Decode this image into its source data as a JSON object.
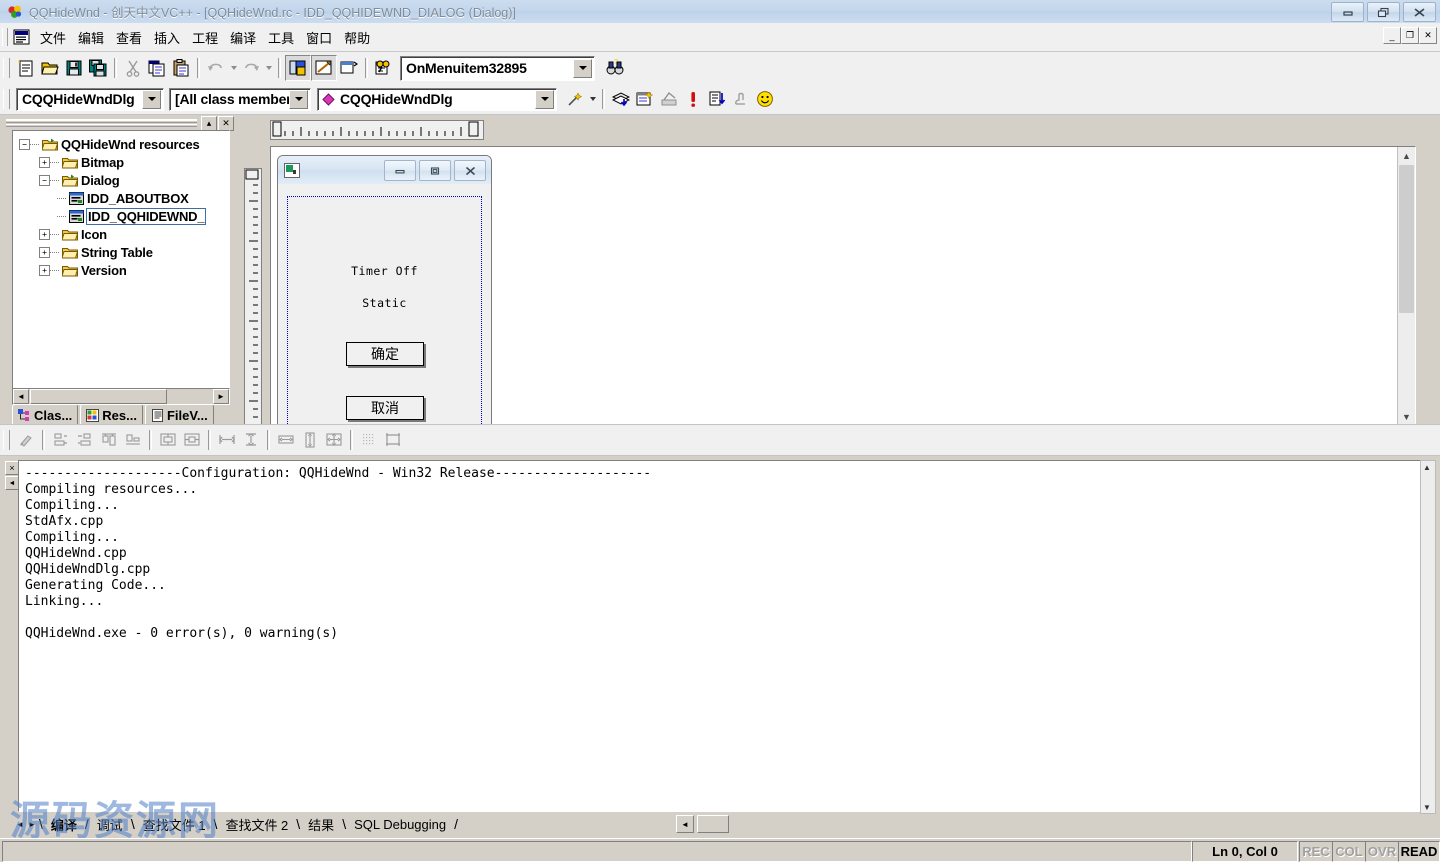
{
  "window": {
    "title": "QQHideWnd - 创天中文VC++ - [QQHideWnd.rc - IDD_QQHIDEWND_DIALOG (Dialog)]",
    "app_icon": "vcpp-logo-icon",
    "minimize_label": "",
    "restore_label": "",
    "close_label": ""
  },
  "menubar": {
    "items": [
      {
        "label": "文件"
      },
      {
        "label": "编辑"
      },
      {
        "label": "查看"
      },
      {
        "label": "插入"
      },
      {
        "label": "工程"
      },
      {
        "label": "编译"
      },
      {
        "label": "工具"
      },
      {
        "label": "窗口"
      },
      {
        "label": "帮助"
      }
    ],
    "mdi": {
      "minimize": "_",
      "restore": "❐",
      "close": "✕"
    }
  },
  "toolbar_standard": {
    "buttons": [
      {
        "name": "new-file-icon",
        "title": "New"
      },
      {
        "name": "open-file-icon",
        "title": "Open"
      },
      {
        "name": "save-icon",
        "title": "Save"
      },
      {
        "name": "save-all-icon",
        "title": "Save All"
      },
      {
        "name": "cut-icon",
        "title": "Cut"
      },
      {
        "name": "copy-icon",
        "title": "Copy"
      },
      {
        "name": "paste-icon",
        "title": "Paste"
      },
      {
        "name": "undo-icon",
        "title": "Undo"
      },
      {
        "name": "redo-icon",
        "title": "Redo"
      },
      {
        "name": "workspace-icon",
        "title": "Workspace"
      },
      {
        "name": "output-window-icon",
        "title": "Output"
      },
      {
        "name": "window-list-icon",
        "title": "Windows"
      },
      {
        "name": "find-in-files-icon",
        "title": "Find in Files"
      },
      {
        "name": "search-binoculars-icon",
        "title": "Find"
      }
    ],
    "find_combo": {
      "value": "OnMenuitem32895",
      "placeholder": "Find"
    }
  },
  "toolbar_wizardbar": {
    "class_combo": {
      "value": "CQQHideWndDlg"
    },
    "filter_combo": {
      "value": "[All class members]"
    },
    "member_combo": {
      "value": "CQQHideWndDlg"
    },
    "buttons": [
      {
        "name": "wizard-wand-icon"
      },
      {
        "name": "compile-icon"
      },
      {
        "name": "build-icon"
      },
      {
        "name": "stop-build-icon"
      },
      {
        "name": "execute-icon"
      },
      {
        "name": "go-debug-icon"
      },
      {
        "name": "insert-breakpoint-icon"
      },
      {
        "name": "smiley-icon"
      }
    ]
  },
  "workspace": {
    "caption_buttons": {
      "maximize": "▴",
      "close": "✕"
    },
    "tree": [
      {
        "label": "QQHideWnd resources",
        "level": 0,
        "expander": "-",
        "icon": "open-folder-icon",
        "selected": false
      },
      {
        "label": "Bitmap",
        "level": 1,
        "expander": "+",
        "icon": "folder-icon",
        "selected": false
      },
      {
        "label": "Dialog",
        "level": 1,
        "expander": "-",
        "icon": "open-folder-icon",
        "selected": false
      },
      {
        "label": "IDD_ABOUTBOX",
        "level": 2,
        "expander": "",
        "icon": "dialog-resource-icon",
        "selected": false
      },
      {
        "label": "IDD_QQHIDEWND_",
        "level": 2,
        "expander": "",
        "icon": "dialog-resource-icon",
        "selected": true
      },
      {
        "label": "Icon",
        "level": 1,
        "expander": "+",
        "icon": "folder-icon",
        "selected": false
      },
      {
        "label": "String Table",
        "level": 1,
        "expander": "+",
        "icon": "folder-icon",
        "selected": false
      },
      {
        "label": "Version",
        "level": 1,
        "expander": "+",
        "icon": "folder-icon",
        "selected": false
      }
    ],
    "tabs": [
      {
        "label": "Clas...",
        "icon": "classview-icon",
        "active": false
      },
      {
        "label": "Res...",
        "icon": "resourceview-icon",
        "active": true
      },
      {
        "label": "FileV...",
        "icon": "fileview-icon",
        "active": false
      }
    ]
  },
  "dialog_editor": {
    "window_icon": "dialog-app-icon",
    "window_buttons": {
      "minimize": "minimize-icon",
      "maximize": "maximize-icon",
      "close": "close-icon"
    },
    "controls": [
      {
        "type": "static",
        "text": "Timer Off"
      },
      {
        "type": "static",
        "text": "Static"
      },
      {
        "type": "button",
        "text": "确定"
      },
      {
        "type": "button",
        "text": "取消"
      }
    ]
  },
  "toolbar_dialog_layout": {
    "buttons": [
      {
        "name": "test-dialog-icon"
      },
      {
        "name": "align-left-icon"
      },
      {
        "name": "align-right-icon"
      },
      {
        "name": "align-top-icon"
      },
      {
        "name": "align-bottom-icon"
      },
      {
        "name": "center-vertical-icon"
      },
      {
        "name": "center-horizontal-icon"
      },
      {
        "name": "space-across-icon"
      },
      {
        "name": "space-down-icon"
      },
      {
        "name": "make-same-width-icon"
      },
      {
        "name": "make-same-height-icon"
      },
      {
        "name": "make-same-size-icon"
      },
      {
        "name": "toggle-grid-icon"
      },
      {
        "name": "toggle-guides-icon"
      }
    ]
  },
  "output": {
    "text": "--------------------Configuration: QQHideWnd - Win32 Release--------------------\nCompiling resources...\nCompiling...\nStdAfx.cpp\nCompiling...\nQQHideWnd.cpp\nQQHideWndDlg.cpp\nGenerating Code...\nLinking...\n\nQQHideWnd.exe - 0 error(s), 0 warning(s)",
    "tabs": [
      {
        "label": "编译",
        "active": true
      },
      {
        "label": "调试",
        "active": false
      },
      {
        "label": "查找文件 1",
        "active": false
      },
      {
        "label": "查找文件 2",
        "active": false
      },
      {
        "label": "结果",
        "active": false
      },
      {
        "label": "SQL Debugging",
        "active": false
      }
    ]
  },
  "watermark": {
    "text": "源码资源网",
    "url": "http://www.net188.com"
  },
  "statusbar": {
    "message": "",
    "position": "Ln 0, Col 0",
    "indicators": [
      {
        "label": "REC",
        "enabled": false
      },
      {
        "label": "COL",
        "enabled": false
      },
      {
        "label": "OVR",
        "enabled": false
      },
      {
        "label": "READ",
        "enabled": true
      }
    ]
  },
  "colors": {
    "title_gradient_top": "#cdddef",
    "chrome": "#f0f0f0",
    "classic_face": "#d4d0c8",
    "selection_border": "#3a6ea5",
    "watermark_blue": "#4f7fc8",
    "watermark_red": "#d14a4a"
  }
}
